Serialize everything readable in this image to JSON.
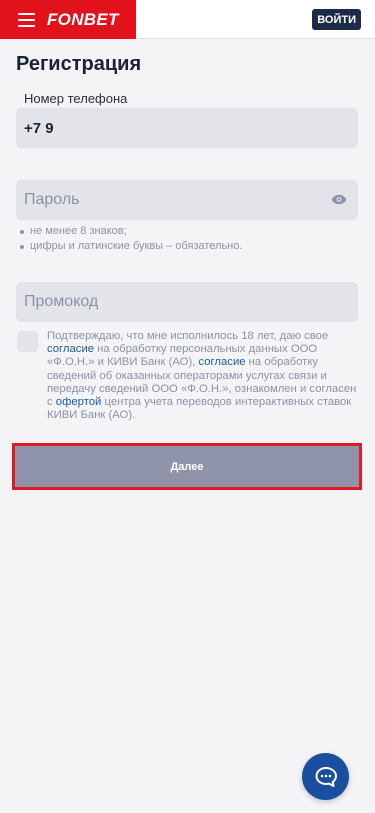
{
  "header": {
    "logo_text": "FONBET",
    "login_label": "ВОЙТИ",
    "menu_icon": "menu-icon",
    "brand_color": "#e1121b"
  },
  "page": {
    "title": "Регистрация"
  },
  "form": {
    "phone_label": "Номер телефона",
    "phone_value": "+7 9",
    "password_placeholder": "Пароль",
    "password_toggle_icon": "eye-icon",
    "password_hints": [
      "не менее 8 знаков;",
      "цифры и латинские буквы – обязательно."
    ],
    "promo_placeholder": "Промокод",
    "consent": {
      "t1": "Подтверждаю, что мне исполнилось 18 лет, даю свое ",
      "link1": "согласие",
      "t2": " на обработку персональных данных ООО «Ф.О.Н.» и КИВИ Банк (АО), ",
      "link2": "согласие",
      "t3": " на обработку сведений об оказанных операторами услугах связи и передачу сведений ООО «Ф.О.Н.», ознакомлен и согласен с ",
      "link3": "офертой",
      "t4": " центра учета переводов интерактивных ставок КИВИ Банк (АО)."
    },
    "next_label": "Далее"
  },
  "chat": {
    "icon": "chat-icon",
    "color": "#1a4fa0"
  }
}
